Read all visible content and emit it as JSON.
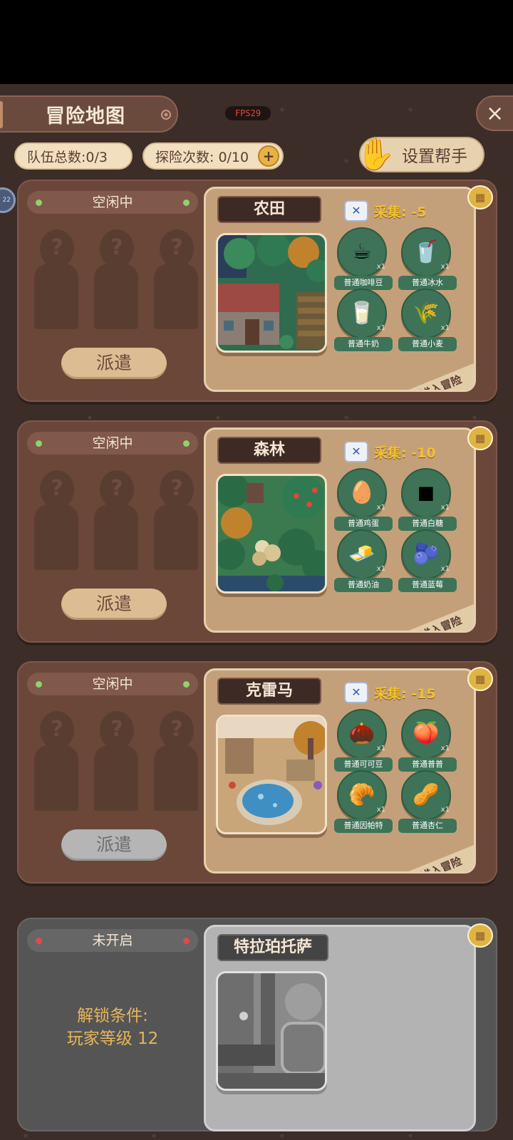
{
  "header": {
    "title": "冒险地图",
    "fps": "FPS29",
    "close_icon": "×",
    "team_total": "队伍总数:0/3",
    "explore_count": "探险次数: 0/10",
    "plus": "+",
    "helper_label": "设置帮手",
    "side_badge": "22"
  },
  "cards": [
    {
      "status": "空闲中",
      "dispatch_label": "派遣",
      "map_name": "农田",
      "collect": "采集: -5",
      "enter_label": "点击进入冒险",
      "items": [
        {
          "name": "普通咖啡豆",
          "qty": "x1",
          "icon": "☕"
        },
        {
          "name": "普通冰水",
          "qty": "x1",
          "icon": "🥤"
        },
        {
          "name": "普通牛奶",
          "qty": "x1",
          "icon": "🥛"
        },
        {
          "name": "普通小麦",
          "qty": "x1",
          "icon": "🌾"
        }
      ]
    },
    {
      "status": "空闲中",
      "dispatch_label": "派遣",
      "map_name": "森林",
      "collect": "采集: -10",
      "enter_label": "点击进入冒险",
      "items": [
        {
          "name": "普通鸡蛋",
          "qty": "x1",
          "icon": "🥚"
        },
        {
          "name": "普通白糖",
          "qty": "x1",
          "icon": "◼"
        },
        {
          "name": "普通奶油",
          "qty": "x1",
          "icon": "🧈"
        },
        {
          "name": "普通蓝莓",
          "qty": "x1",
          "icon": "🫐"
        }
      ]
    },
    {
      "status": "空闲中",
      "dispatch_label": "派遣",
      "map_name": "克雷马",
      "collect": "采集: -15",
      "enter_label": "点击进入冒险",
      "items": [
        {
          "name": "普通可可豆",
          "qty": "x1",
          "icon": "🌰"
        },
        {
          "name": "普通普普",
          "qty": "x1",
          "icon": "🍑"
        },
        {
          "name": "普通因帕特",
          "qty": "x1",
          "icon": "🥐"
        },
        {
          "name": "普通杏仁",
          "qty": "x1",
          "icon": "🥜"
        }
      ]
    },
    {
      "status": "未开启",
      "map_name": "特拉珀托萨",
      "unlock_line1": "解锁条件:",
      "unlock_line2": "玩家等级 12"
    }
  ]
}
